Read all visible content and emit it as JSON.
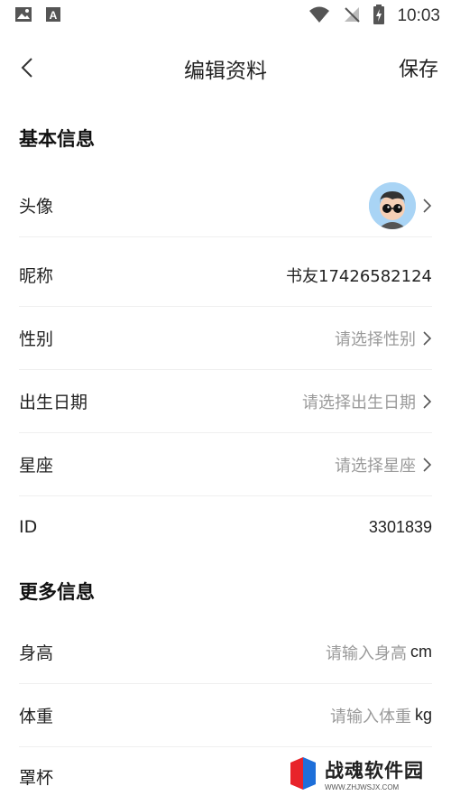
{
  "status_bar": {
    "time": "10:03",
    "left_icons": [
      "image-icon",
      "a-badge-icon"
    ],
    "right_icons": [
      "wifi-icon",
      "no-signal-icon",
      "battery-charging-icon"
    ]
  },
  "header": {
    "title": "编辑资料",
    "save_label": "保存",
    "back_icon": "chevron-left-icon"
  },
  "sections": {
    "basic": {
      "title": "基本信息",
      "avatar_label": "头像",
      "nickname_label": "昵称",
      "nickname_value": "书友17426582124",
      "gender_label": "性别",
      "gender_placeholder": "请选择性别",
      "birthday_label": "出生日期",
      "birthday_placeholder": "请选择出生日期",
      "zodiac_label": "星座",
      "zodiac_placeholder": "请选择星座",
      "id_label": "ID",
      "id_value": "3301839"
    },
    "more": {
      "title": "更多信息",
      "height_label": "身高",
      "height_placeholder": "请输入身高",
      "height_unit": "cm",
      "weight_label": "体重",
      "weight_placeholder": "请输入体重",
      "weight_unit": "kg",
      "cup_label": "罩杯"
    }
  },
  "watermark": {
    "main": "战魂软件园",
    "sub": "WWW.ZHJWSJX.COM"
  },
  "colors": {
    "text": "#222222",
    "placeholder": "#9a9a9a",
    "divider": "#efefef",
    "avatar_bg": "#a9d4f5"
  }
}
